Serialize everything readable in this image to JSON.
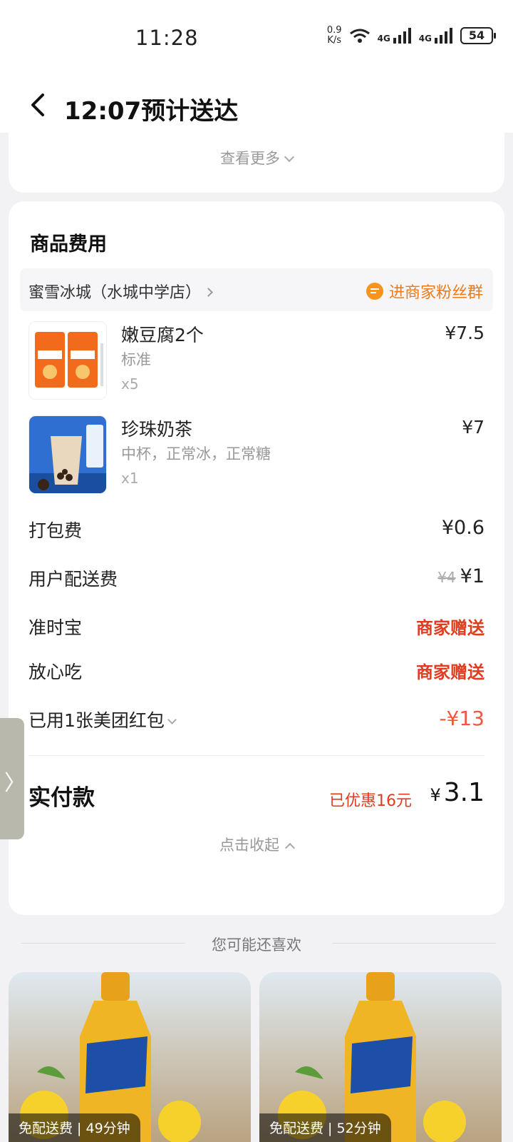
{
  "status": {
    "time": "11:28",
    "net_speed_top": "0.9",
    "net_speed_bottom": "K/s",
    "signal1": "4G",
    "signal2": "4G",
    "battery": "54"
  },
  "header": {
    "title": "12:07预计送达",
    "back_icon": "chevron-left-icon"
  },
  "top_card": {
    "more_label": "查看更多"
  },
  "fee": {
    "section_title": "商品费用",
    "shop_name": "蜜雪冰城（水城中学店）",
    "fan_group_label": "进商家粉丝群",
    "items": [
      {
        "name": "嫩豆腐2个",
        "spec": "标准",
        "qty": "x5",
        "price": "¥7.5"
      },
      {
        "name": "珍珠奶茶",
        "spec": "中杯，正常冰，正常糖",
        "qty": "x1",
        "price": "¥7"
      }
    ],
    "rows": {
      "packing": {
        "label": "打包费",
        "value": "¥0.6"
      },
      "delivery": {
        "label": "用户配送费",
        "old": "¥4",
        "value": "¥1"
      },
      "ontime": {
        "label": "准时宝",
        "value": "商家赠送"
      },
      "safe": {
        "label": "放心吃",
        "value": "商家赠送"
      },
      "coupon": {
        "label": "已用1张美团红包",
        "value": "-¥13"
      }
    },
    "paid_label": "实付款",
    "saved_label": "已优惠16元",
    "paid_yen": "¥",
    "paid_value": "3.1",
    "collapse_label": "点击收起"
  },
  "recommend": {
    "heading": "您可能还喜欢",
    "cards": [
      {
        "badge": "免配送费 | 49分钟"
      },
      {
        "badge": "免配送费 | 52分钟"
      }
    ]
  },
  "colors": {
    "accent_red": "#e03c1f",
    "accent_orange": "#f07a1a"
  }
}
